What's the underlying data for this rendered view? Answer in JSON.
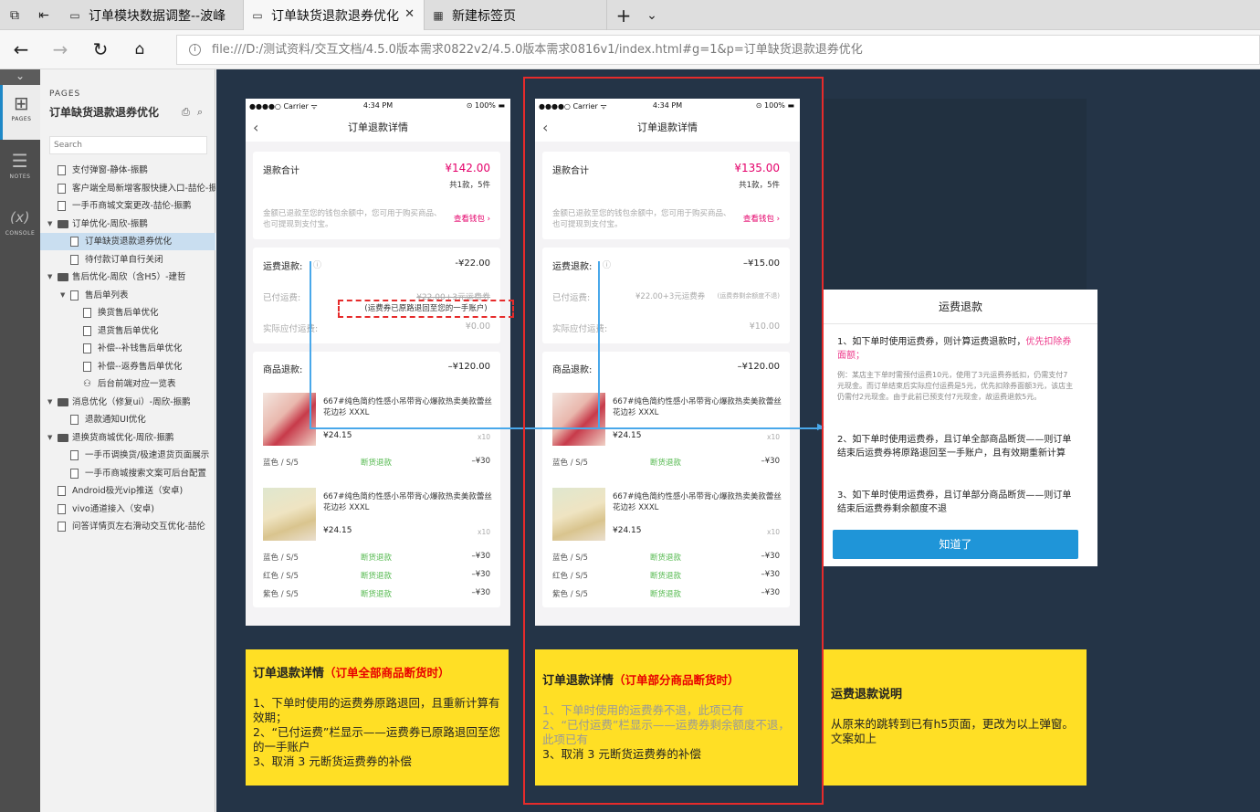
{
  "tabs": [
    {
      "label": "订单模块数据调整--波峰"
    },
    {
      "label": "订单缺货退款退券优化"
    },
    {
      "label": "新建标签页"
    }
  ],
  "address": {
    "url": "file:///D:/测试资料/交互文档/4.5.0版本需求0822v2/4.5.0版本需求0816v1/index.html#g=1&p=订单缺货退款退券优化"
  },
  "rail": {
    "pages": "PAGES",
    "notes": "NOTES",
    "console": "CONSOLE",
    "console_icon": "(x)"
  },
  "sidebar": {
    "pages_label": "PAGES",
    "title": "订单缺货退款退券优化",
    "search_placeholder": "Search",
    "tree": [
      {
        "label": "支付弹窗-静体-振鹏",
        "type": "file",
        "level": 0
      },
      {
        "label": "客户端全局新增客服快捷入口-喆伦-振",
        "type": "file",
        "level": 0
      },
      {
        "label": "一手币商城文案更改-喆伦-振鹏",
        "type": "file",
        "level": 0
      },
      {
        "label": "订单优化-周欣-振鹏",
        "type": "folder",
        "level": 0
      },
      {
        "label": "订单缺货退款退券优化",
        "type": "file",
        "level": 1,
        "selected": true
      },
      {
        "label": "待付款订单自行关闭",
        "type": "file",
        "level": 1
      },
      {
        "label": "售后优化-周欣（含H5）-建哲",
        "type": "folder",
        "level": 0
      },
      {
        "label": "售后单列表",
        "type": "file-open",
        "level": 1
      },
      {
        "label": "换货售后单优化",
        "type": "file",
        "level": 2
      },
      {
        "label": "退货售后单优化",
        "type": "file",
        "level": 2
      },
      {
        "label": "补偿--补钱售后单优化",
        "type": "file",
        "level": 2
      },
      {
        "label": "补偿--返券售后单优化",
        "type": "file",
        "level": 2
      },
      {
        "label": "后台前端对应一览表",
        "type": "special",
        "level": 2
      },
      {
        "label": "消息优化（修复ui）-周欣-振鹏",
        "type": "folder",
        "level": 0
      },
      {
        "label": "退款通知UI优化",
        "type": "file",
        "level": 1
      },
      {
        "label": "退换货商城优化-周欣-振鹏",
        "type": "folder",
        "level": 0
      },
      {
        "label": "一手币调换货/极速退货页面展示",
        "type": "file",
        "level": 1
      },
      {
        "label": "一手币商城搜索文案可后台配置",
        "type": "file",
        "level": 1
      },
      {
        "label": "Android极光vip推送（安卓)",
        "type": "file",
        "level": 0
      },
      {
        "label": "vivo通道接入（安卓)",
        "type": "file",
        "level": 0
      },
      {
        "label": "问答详情页左右滑动交互优化-喆伦",
        "type": "file",
        "level": 0
      }
    ]
  },
  "phones": [
    {
      "status": {
        "carrier": "●●●●○ Carrier ᯤ",
        "time": "4:34 PM",
        "battery": "⊙ 100% ▬"
      },
      "nav_title": "订单退款详情",
      "refund_total_label": "退款合计",
      "refund_total": "¥142.00",
      "refund_count": "共1款，5件",
      "refund_desc": "金额已退款至您的钱包余额中，您可用于购买商品、也可提现到支付宝。",
      "wallet_link": "查看钱包 ›",
      "shipping_label": "运费退款:",
      "shipping_value": "-¥22.00",
      "paid_label": "已付运费:",
      "paid_value": "¥22.00+3元运费券",
      "actual_label": "实际应付运费:",
      "actual_value": "¥0.00",
      "goods_label": "商品退款:",
      "goods_value": "–¥120.00",
      "product_name": "667#纯色简约性感小吊带背心爆款热卖美款蕾丝花边衫 XXXL",
      "product_price": "¥24.15",
      "product_qty": "x10",
      "variant1": "蓝色 / S/5",
      "status1": "断货退款",
      "amt1": "–¥30",
      "variants2": [
        {
          "v": "蓝色 / S/5",
          "s": "断货退款",
          "a": "–¥30"
        },
        {
          "v": "红色 / S/5",
          "s": "断货退款",
          "a": "–¥30"
        },
        {
          "v": "紫色 / S/5",
          "s": "断货退款",
          "a": "–¥30"
        }
      ],
      "annotation": "(运费券已原路退回至您的一手账户)"
    },
    {
      "status": {
        "carrier": "●●●●○ Carrier ᯤ",
        "time": "4:34 PM",
        "battery": "⊙ 100% ▬"
      },
      "nav_title": "订单退款详情",
      "refund_total_label": "退款合计",
      "refund_total": "¥135.00",
      "refund_count": "共1款，5件",
      "refund_desc": "金额已退款至您的钱包余额中，您可用于购买商品、也可提现到支付宝。",
      "wallet_link": "查看钱包 ›",
      "shipping_label": "运费退款:",
      "shipping_value": "–¥15.00",
      "paid_label": "已付运费:",
      "paid_value": "¥22.00+3元运费券",
      "paid_note": "(运费券剩余额度不退)",
      "actual_label": "实际应付运费:",
      "actual_value": "¥10.00",
      "goods_label": "商品退款:",
      "goods_value": "–¥120.00",
      "product_name": "667#纯色简约性感小吊带背心爆款热卖美款蕾丝花边衫 XXXL",
      "product_price": "¥24.15",
      "product_qty": "x10",
      "variant1": "蓝色 / S/5",
      "status1": "断货退款",
      "amt1": "–¥30",
      "variants2": [
        {
          "v": "蓝色 / S/5",
          "s": "断货退款",
          "a": "–¥30"
        },
        {
          "v": "红色 / S/5",
          "s": "断货退款",
          "a": "–¥30"
        },
        {
          "v": "紫色 / S/5",
          "s": "断货退款",
          "a": "–¥30"
        }
      ]
    }
  ],
  "modal": {
    "title": "运费退款",
    "p1a": "1、如下单时使用运费券，则计算运费退款时，",
    "p1b": "优先扣除券面额；",
    "p1ex": "例：某店主下单时需预付运费10元，使用了3元运费券抵扣，仍需支付7元现金。而订单结束后实际应付运费是5元，优先扣除券面额3元，该店主仍需付2元现金。由于此前已预支付7元现金，故运费退款5元。",
    "p2": "2、如下单时使用运费券，且订单全部商品断货——则订单结束后运费券将原路退回至一手账户，且有效期重新计算",
    "p3": "3、如下单时使用运费券，且订单部分商品断货——则订单结束后运费券剩余额度不退",
    "btn": "知道了"
  },
  "notes": [
    {
      "title": "订单退款详情",
      "highlight": "（订单全部商品断货时）",
      "lines": [
        "1、下单时使用的运费券原路退回，且重新计算有效期；",
        "2、“已付运费”栏显示——运费券已原路退回至您的一手账户",
        "3、取消 3 元断货运费券的补偿"
      ]
    },
    {
      "title": "订单退款详情",
      "highlight": "（订单部分商品断货时）",
      "gray": [
        "1、下单时使用的运费券不退，此项已有",
        "2、“已付运费”栏显示——运费券剩余额度不退，此项已有"
      ],
      "lines": [
        "3、取消 3 元断货运费券的补偿"
      ]
    },
    {
      "title": "运费退款说明",
      "lines": [
        "从原来的跳转到已有h5页面，更改为以上弹窗。文案如上"
      ]
    }
  ],
  "colors": {
    "canvas": "#243447",
    "sticky": "#ffdf25",
    "accent": "#e4006a",
    "link_blue": "#49a8ea",
    "button_blue": "#1f95d8",
    "red_border": "#e62b2b"
  }
}
